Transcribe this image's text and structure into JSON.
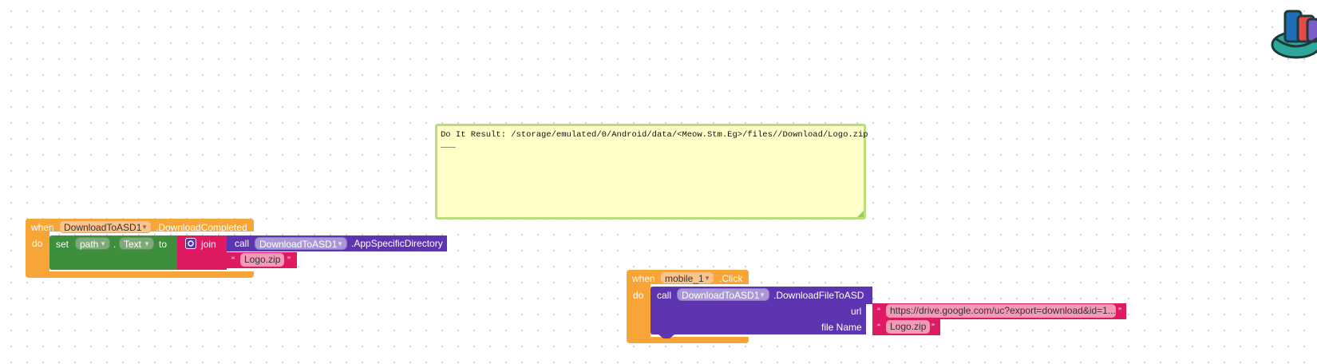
{
  "comment": {
    "result_text": "Do It Result: /storage/emulated/0/Android/data/<Meow.Stm.Eg>/files//Download/Logo.zip",
    "extra_line": "___"
  },
  "event1": {
    "when": "when",
    "component": "DownloadToASD1",
    "event": ".DownloadCompleted",
    "do": "do",
    "set_kw": "set",
    "path_dropdown": "path",
    "dot": ".",
    "prop_dropdown": "Text",
    "to_kw": "to",
    "join_kw": "join",
    "call_kw": "call",
    "call_component": "DownloadToASD1",
    "call_method": ".AppSpecificDirectory",
    "string": "Logo.zip"
  },
  "event2": {
    "when": "when",
    "component": "mobile_1",
    "event": ".Click",
    "do": "do",
    "call_kw": "call",
    "call_component": "DownloadToASD1",
    "call_method": ".DownloadFileToASD",
    "url_label": "url",
    "url_value": "https://drive.google.com/uc?export=download&id=1...",
    "filename_label": "file Name",
    "filename_value": "Logo.zip"
  },
  "colors": {
    "event": "#f7a537",
    "set_block": "#3d8f3d",
    "text_block": "#dd1a62",
    "call_block": "#5e35b1",
    "comment_bg": "#ffffc8"
  }
}
